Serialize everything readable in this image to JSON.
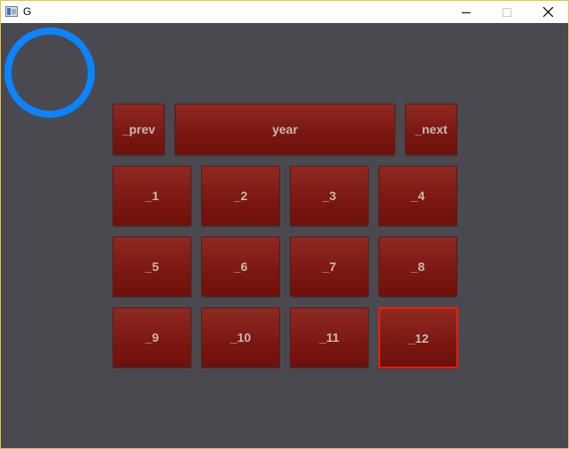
{
  "window": {
    "title": "G"
  },
  "nav": {
    "prev_label": "_prev",
    "year_label": "year",
    "next_label": "_next"
  },
  "months": [
    "_1",
    "_2",
    "_3",
    "_4",
    "_5",
    "_6",
    "_7",
    "_8",
    "_9",
    "_10",
    "_11",
    "_12"
  ],
  "selected_month": "_12",
  "colors": {
    "ring": "#0a84ff",
    "button": "#7a1710",
    "selected_border": "#ff1a0a",
    "background": "#4a494f"
  }
}
